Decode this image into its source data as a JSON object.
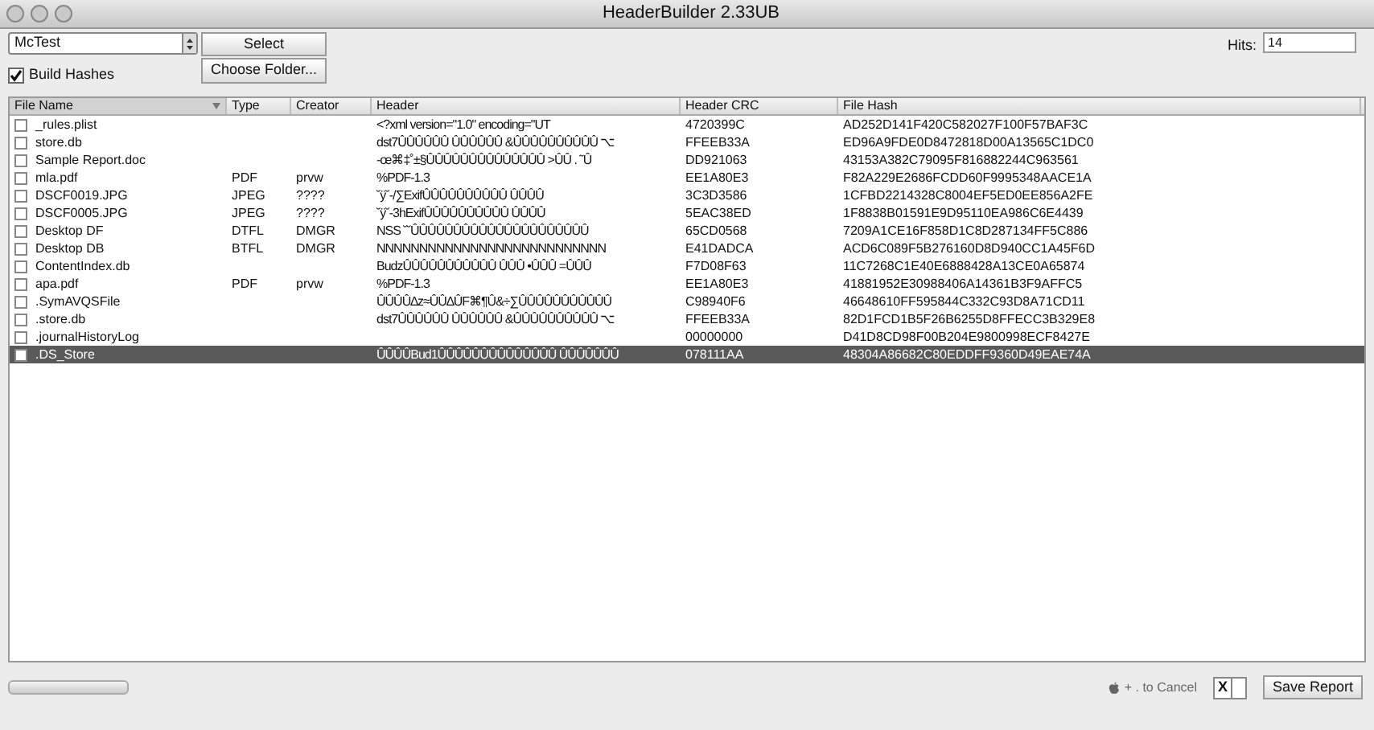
{
  "window": {
    "title": "HeaderBuilder 2.33UB"
  },
  "volume_popup": {
    "value": "McTest"
  },
  "select_button": "Select",
  "choose_folder_button": "Choose Folder...",
  "build_hashes": {
    "label": "Build Hashes",
    "checked": true
  },
  "hits": {
    "label": "Hits:",
    "value": "14"
  },
  "table": {
    "columns": [
      "File Name",
      "Type",
      "Creator",
      "Header",
      "Header CRC",
      "File Hash"
    ],
    "rows": [
      {
        "checked": false,
        "selected": false,
        "cells": [
          "_rules.plist",
          "",
          "",
          "<?xml version=\"1.0\" encoding=\"UT",
          "4720399C",
          "AD252D141F420C582027F100F57BAF3C"
        ]
      },
      {
        "checked": false,
        "selected": false,
        "cells": [
          "store.db",
          "",
          "",
          "dst7ÛÛÛÛÛÛ ÛÛÛÛÛÛ &ÛÛÛÛÛÛÛÛÛÛ ⌥",
          "FFEEB33A",
          "ED96A9FDE0D8472818D00A13565C1DC0"
        ]
      },
      {
        "checked": false,
        "selected": false,
        "cells": [
          "Sample Report.doc",
          "",
          "",
          "-œ⌘‡˚±§ÛÛÛÛÛÛÛÛÛÛÛÛÛÛ >ÛÛ . ˜Û",
          "DD921063",
          "43153A382C79095F816882244C963561"
        ]
      },
      {
        "checked": false,
        "selected": false,
        "cells": [
          "mla.pdf",
          "PDF",
          "prvw",
          "%PDF-1.3",
          "EE1A80E3",
          "F82A229E2686FCDD60F9995348AACE1A"
        ]
      },
      {
        "checked": false,
        "selected": false,
        "cells": [
          "DSCF0019.JPG",
          "JPEG",
          "????",
          "˘ÿ˘-/∑ExifÛÛÛÛÛÛÛÛÛÛ ÛÛÛÛ",
          "3C3D3586",
          "1CFBD2214328C8004EF5ED0EE856A2FE"
        ]
      },
      {
        "checked": false,
        "selected": false,
        "cells": [
          "DSCF0005.JPG",
          "JPEG",
          "????",
          "˘ÿ˘-3hExifÛÛÛÛÛÛÛÛÛÛ ÛÛÛÛ",
          "5EAC38ED",
          "1F8838B01591E9D95110EA986C6E4439"
        ]
      },
      {
        "checked": false,
        "selected": false,
        "cells": [
          "Desktop DF",
          "DTFL",
          "DMGR",
          "NSS ˘˘ÛÛÛÛÛÛÛÛÛÛÛÛÛÛÛÛÛÛÛÛÛ",
          "65CD0568",
          "7209A1CE16F858D1C8D287134FF5C886"
        ]
      },
      {
        "checked": false,
        "selected": false,
        "cells": [
          "Desktop DB",
          "BTFL",
          "DMGR",
          "NNNNNNNNNNNNNNNNNNNNNNNNNNN",
          "E41DADCA",
          "ACD6C089F5B276160D8D940CC1A45F6D"
        ]
      },
      {
        "checked": false,
        "selected": false,
        "cells": [
          "ContentIndex.db",
          "",
          "",
          "BudzÛÛÛÛÛÛÛÛÛÛÛ ÛÛÛ •ÛÛÛ =ÛÛÛ",
          "F7D08F63",
          "11C7268C1E40E6888428A13CE0A65874"
        ]
      },
      {
        "checked": false,
        "selected": false,
        "cells": [
          "apa.pdf",
          "PDF",
          "prvw",
          "%PDF-1.3",
          "EE1A80E3",
          "41881952E30988406A14361B3F9AFFC5"
        ]
      },
      {
        "checked": false,
        "selected": false,
        "cells": [
          ".SymAVQSFile",
          "",
          "",
          "ÛÛÛÛ∆z≈ÛÛ∆ÛF⌘¶Û&÷∑ÛÛÛÛÛÛÛÛÛÛÛ",
          "C98940F6",
          "46648610FF595844C332C93D8A71CD11"
        ]
      },
      {
        "checked": false,
        "selected": false,
        "cells": [
          ".store.db",
          "",
          "",
          "dst7ÛÛÛÛÛÛ ÛÛÛÛÛÛ &ÛÛÛÛÛÛÛÛÛÛ ⌥",
          "FFEEB33A",
          "82D1FCD1B5F26B6255D8FFECC3B329E8"
        ]
      },
      {
        "checked": false,
        "selected": false,
        "cells": [
          ".journalHistoryLog",
          "",
          "",
          "",
          "00000000",
          "D41D8CD98F00B204E9800998ECF8427E"
        ]
      },
      {
        "checked": false,
        "selected": true,
        "cells": [
          ".DS_Store",
          "",
          "",
          "ÛÛÛÛBud1ÛÛÛÛÛÛÛÛÛÛÛÛÛÛ ÛÛÛÛÛÛÛ",
          "078111AA",
          "48304A86682C80EDDFF9360D49EAE74A"
        ]
      }
    ]
  },
  "progress": {
    "level": 0
  },
  "cancel_hint": "+ . to Cancel",
  "cancel_key": "X",
  "save_button": "Save Report"
}
